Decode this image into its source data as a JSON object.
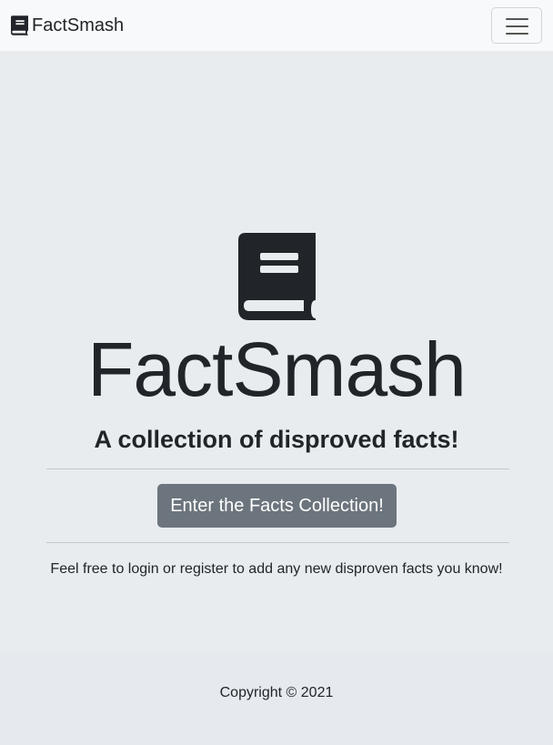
{
  "navbar": {
    "brand_label": "FactSmash",
    "brand_icon": "book-icon",
    "menu_icon": "hamburger-menu-icon"
  },
  "hero": {
    "icon": "book-icon",
    "title": "FactSmash",
    "subtitle": "A collection of disproved facts!",
    "cta_label": "Enter the Facts Collection!",
    "info_text": "Feel free to login or register to add any new disproven facts you know!"
  },
  "footer": {
    "copyright": "Copyright © 2021"
  },
  "colors": {
    "navbar_bg": "#f8f9fa",
    "page_bg": "#e9ecef",
    "text": "#212529",
    "button_bg": "#6c757d",
    "button_text": "#ffffff"
  }
}
